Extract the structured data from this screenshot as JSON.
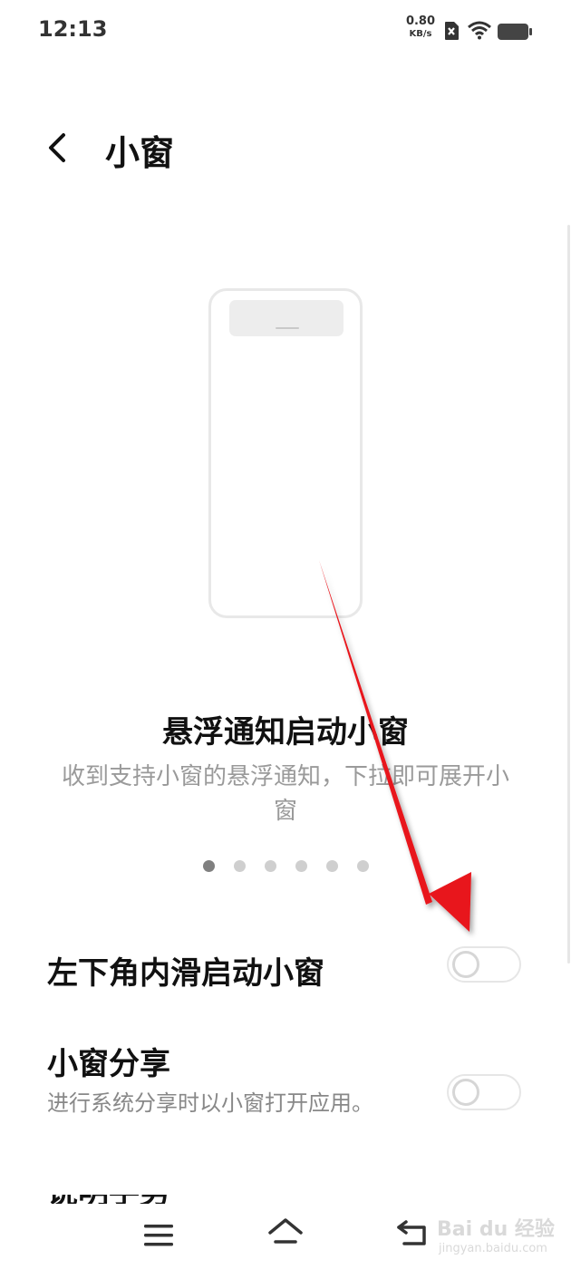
{
  "status_bar": {
    "time": "12:13",
    "net_speed_value": "0.80",
    "net_speed_unit": "KB/s",
    "icons": [
      "sim-x-icon",
      "wifi-icon",
      "battery-icon"
    ]
  },
  "header": {
    "back_icon": "chevron-left-icon",
    "title": "小窗"
  },
  "feature": {
    "title": "悬浮通知启动小窗",
    "description": "收到支持小窗的悬浮通知，下拉即可展开小窗",
    "page_count": 6,
    "active_page": 1
  },
  "settings": [
    {
      "title": "左下角内滑启动小窗",
      "description": "",
      "enabled": false
    },
    {
      "title": "小窗分享",
      "description": "进行系统分享时以小窗打开应用。",
      "enabled": false
    }
  ],
  "partial_row_title": "说明手势",
  "nav_bar": {
    "icons": [
      "menu-icon",
      "home-icon",
      "back-icon"
    ]
  },
  "annotation": {
    "arrow_color": "#e8141b"
  },
  "watermark": {
    "logo": "Bai du 经验",
    "sub": "jingyan.baidu.com"
  }
}
